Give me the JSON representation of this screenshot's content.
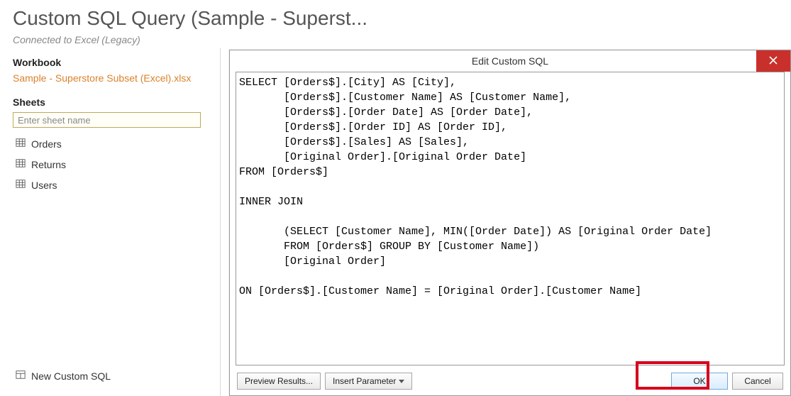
{
  "header": {
    "title": "Custom SQL Query (Sample - Superst...",
    "subtitle": "Connected to Excel (Legacy)"
  },
  "left": {
    "workbook_label": "Workbook",
    "workbook_name": "Sample - Superstore Subset (Excel).xlsx",
    "sheets_label": "Sheets",
    "sheet_placeholder": "Enter sheet name",
    "sheets": [
      {
        "label": "Orders"
      },
      {
        "label": "Returns"
      },
      {
        "label": "Users"
      }
    ],
    "new_custom_sql": "New Custom SQL"
  },
  "dialog": {
    "title": "Edit Custom SQL",
    "sql": "SELECT [Orders$].[City] AS [City],\n       [Orders$].[Customer Name] AS [Customer Name],\n       [Orders$].[Order Date] AS [Order Date],\n       [Orders$].[Order ID] AS [Order ID],\n       [Orders$].[Sales] AS [Sales],\n       [Original Order].[Original Order Date]\nFROM [Orders$]\n\nINNER JOIN\n\n       (SELECT [Customer Name], MIN([Order Date]) AS [Original Order Date]\n       FROM [Orders$] GROUP BY [Customer Name])\n       [Original Order]\n\nON [Orders$].[Customer Name] = [Original Order].[Customer Name]",
    "preview_label": "Preview Results...",
    "insert_param_label": "Insert Parameter",
    "ok_label": "OK",
    "cancel_label": "Cancel"
  }
}
